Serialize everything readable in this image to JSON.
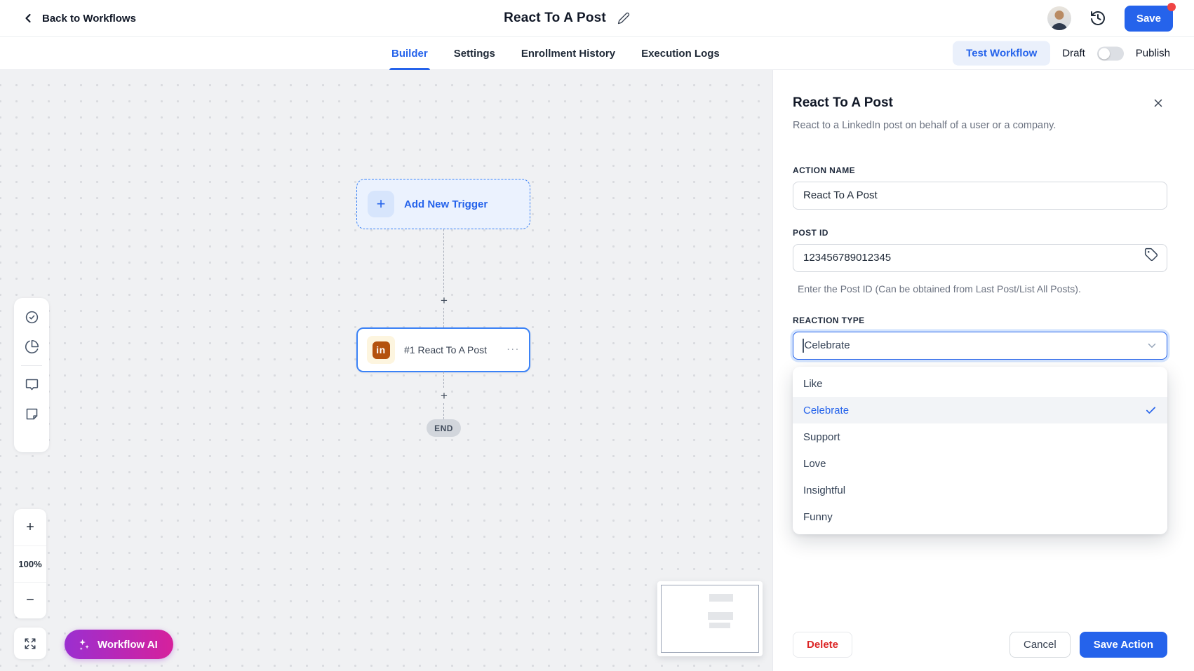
{
  "header": {
    "back_label": "Back to Workflows",
    "title": "React To A Post",
    "save_label": "Save"
  },
  "tabs": {
    "items": [
      {
        "label": "Builder",
        "active": true
      },
      {
        "label": "Settings",
        "active": false
      },
      {
        "label": "Enrollment History",
        "active": false
      },
      {
        "label": "Execution Logs",
        "active": false
      }
    ],
    "test_workflow_label": "Test Workflow",
    "draft_label": "Draft",
    "publish_label": "Publish"
  },
  "canvas": {
    "trigger_label": "Add New Trigger",
    "trigger_plus": "+",
    "connector_plus": "+",
    "action_node_label": "#1 React To A Post",
    "action_node_menu": "...",
    "linkedin_glyph": "in",
    "end_label": "END",
    "zoom_in": "+",
    "zoom_level": "100%",
    "zoom_out": "−",
    "workflow_ai_label": "Workflow AI"
  },
  "panel": {
    "title": "React To A Post",
    "description": "React to a LinkedIn post on behalf of a user or a company.",
    "action_name": {
      "label": "ACTION NAME",
      "value": "React To A Post"
    },
    "post_id": {
      "label": "POST ID",
      "value": "123456789012345",
      "helper": "Enter the Post ID (Can be obtained from Last Post/List All Posts)."
    },
    "reaction_type": {
      "label": "REACTION TYPE",
      "value": "Celebrate",
      "selected": "Celebrate",
      "options": [
        "Like",
        "Celebrate",
        "Support",
        "Love",
        "Insightful",
        "Funny"
      ]
    },
    "delete_label": "Delete",
    "cancel_label": "Cancel",
    "save_action_label": "Save Action"
  },
  "icons": {
    "back": "chevron-left",
    "edit": "pencil",
    "history": "clock-history",
    "close": "x",
    "post_id_field": "tag",
    "select": "chevron-down",
    "selected_option": "check",
    "toolbar": [
      "circle-check",
      "pie-chart",
      "comment-bubble",
      "sticky-note"
    ],
    "fullscreen": "expand-arrows",
    "workflow_ai": "sparkles"
  },
  "colors": {
    "accent_blue": "#2563eb",
    "node_border_blue": "#3b82f6",
    "danger_red": "#dc2626",
    "notification_dot": "#ef4444",
    "linkedin_tile": "#b4520e",
    "linkedin_tile_bg": "#fdf5df",
    "ai_gradient_start": "#9b2fd0",
    "ai_gradient_end": "#d6219c",
    "canvas_bg": "#f0f1f3",
    "end_pill_bg": "#d2d6dc"
  }
}
